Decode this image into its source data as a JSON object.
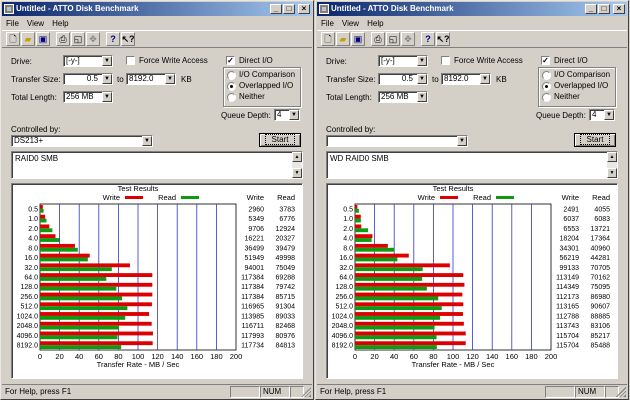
{
  "colors": {
    "write": "#dd0000",
    "read": "#119911",
    "grid": "#3333cc",
    "title_start": "#0a246a",
    "title_end": "#a6caf0"
  },
  "icons": {
    "app": "disk-icon",
    "minimize": "minimize-icon",
    "maximize": "maximize-icon",
    "close": "close-icon"
  },
  "menu": [
    "File",
    "View",
    "Help"
  ],
  "toolbar_icons": [
    "new-file-icon",
    "open-folder-icon",
    "save-icon",
    "print-icon",
    "print-preview-icon",
    "move-icon",
    "help-icon",
    "context-help-icon"
  ],
  "labels": {
    "drive": "Drive:",
    "force_write": "Force Write Access",
    "direct_io": "Direct I/O",
    "transfer_size": "Transfer Size:",
    "to": "to",
    "kb": "KB",
    "io_comparison": "I/O Comparison",
    "overlapped_io": "Overlapped I/O",
    "neither": "Neither",
    "total_length": "Total Length:",
    "queue_depth": "Queue Depth:",
    "controlled_by": "Controlled by:",
    "start": "Start",
    "test_results": "Test Results",
    "write": "Write",
    "read": "Read",
    "xaxis": "Transfer Rate - MB / Sec",
    "col_write": "Write",
    "col_read": "Read"
  },
  "status": {
    "help": "For Help, press F1",
    "num": "NUM"
  },
  "windows": [
    {
      "title": "Untitled - ATTO Disk Benchmark",
      "drive": "[-y-]",
      "transfer_from": "0.5",
      "transfer_to": "8192.0",
      "total_length": "256 MB",
      "queue_depth": "4",
      "controlled_by": "DS213+",
      "description": "RAID0 SMB",
      "force_write": false,
      "direct_io": true,
      "io_mode": "overlapped"
    },
    {
      "title": "Untitled - ATTO Disk Benchmark",
      "drive": "[-y-]",
      "transfer_from": "0.5",
      "transfer_to": "8192.0",
      "total_length": "256 MB",
      "queue_depth": "4",
      "controlled_by": "",
      "description": "WD RAID0 SMB",
      "force_write": false,
      "direct_io": true,
      "io_mode": "overlapped"
    }
  ],
  "chart_data": [
    {
      "type": "bar",
      "title": "Test Results",
      "xlabel": "Transfer Rate - MB / Sec",
      "xlim": [
        0,
        200
      ],
      "xticks": [
        0,
        20,
        40,
        60,
        80,
        100,
        120,
        140,
        160,
        180,
        200
      ],
      "grid": true,
      "categories": [
        "0.5",
        "1.0",
        "2.0",
        "4.0",
        "8.0",
        "16.0",
        "32.0",
        "64.0",
        "128.0",
        "256.0",
        "512.0",
        "1024.0",
        "2048.0",
        "4096.0",
        "8192.0"
      ],
      "series": [
        {
          "name": "Write",
          "values": [
            2960,
            5349,
            9706,
            16221,
            36499,
            51949,
            94001,
            117384,
            117384,
            117384,
            116965,
            113985,
            116711,
            117993,
            117734
          ]
        },
        {
          "name": "Read",
          "values": [
            3783,
            6776,
            12924,
            20327,
            39479,
            49998,
            75049,
            69288,
            79742,
            85715,
            91304,
            89033,
            82468,
            80976,
            84813
          ]
        }
      ]
    },
    {
      "type": "bar",
      "title": "Test Results",
      "xlabel": "Transfer Rate - MB / Sec",
      "xlim": [
        0,
        200
      ],
      "xticks": [
        0,
        20,
        40,
        60,
        80,
        100,
        120,
        140,
        160,
        180,
        200
      ],
      "grid": true,
      "categories": [
        "0.5",
        "1.0",
        "2.0",
        "4.0",
        "8.0",
        "16.0",
        "32.0",
        "64.0",
        "128.0",
        "256.0",
        "512.0",
        "1024.0",
        "2048.0",
        "4096.0",
        "8192.0"
      ],
      "series": [
        {
          "name": "Write",
          "values": [
            2491,
            6037,
            6553,
            18204,
            34301,
            56219,
            99133,
            113149,
            114349,
            112173,
            113165,
            112788,
            113743,
            115704,
            115704
          ]
        },
        {
          "name": "Read",
          "values": [
            4055,
            6083,
            13721,
            17364,
            40960,
            44281,
            70705,
            70162,
            75095,
            86980,
            90607,
            88885,
            83106,
            85217,
            85488
          ]
        }
      ]
    }
  ]
}
